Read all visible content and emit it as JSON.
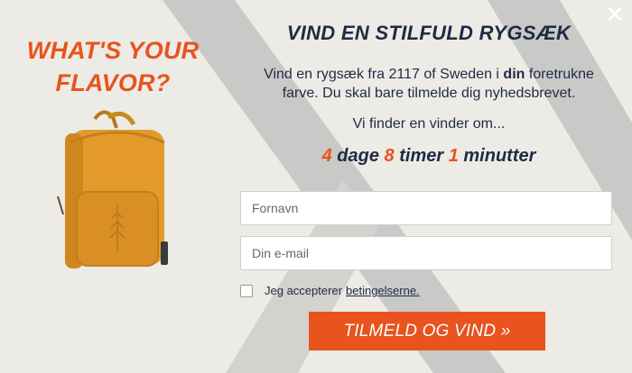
{
  "popup": {
    "close_glyph": "✕",
    "left_title_line1": "WHAT'S YOUR",
    "left_title_line2": "FLAVOR?",
    "title": "VIND EN STILFULD RYGSÆK",
    "description_part1": "Vind en rygsæk fra 2117 of Sweden i ",
    "description_bold": "din",
    "description_part2": " foretrukne farve. Du skal bare tilmelde dig nyhedsbrevet.",
    "winner_text": "Vi finder en vinder om...",
    "countdown": {
      "days_value": "4",
      "days_label": "dage",
      "hours_value": "8",
      "hours_label": "timer",
      "minutes_value": "1",
      "minutes_label": "minutter"
    },
    "form": {
      "first_name_placeholder": "Fornavn",
      "email_placeholder": "Din e-mail",
      "consent_text": "Jeg accepterer",
      "terms_link": "betingelserne.",
      "submit_label": "TILMELD OG VIND »"
    }
  },
  "colors": {
    "accent": "#e8531e",
    "navy": "#1f2a44",
    "background": "#ecebe6",
    "backpack": "#e39a2a"
  },
  "icons": {
    "close": "close-icon",
    "product": "backpack-image"
  }
}
